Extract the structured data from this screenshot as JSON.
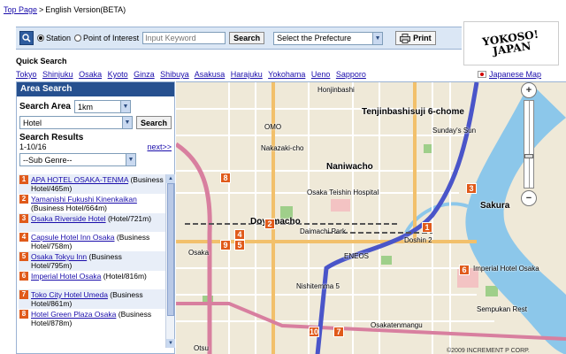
{
  "topnav": {
    "top_page": "Top Page",
    "separator": ">",
    "current": "English Version(BETA)"
  },
  "logo": {
    "line1": "YOKOSO!",
    "line2": "JAPAN"
  },
  "searchbar": {
    "radio_station": "Station",
    "radio_poi": "Point of Interest",
    "keyword_placeholder": "Input Keyword",
    "search_btn": "Search",
    "prefecture_label": "Select the Prefecture",
    "print_btn": "Print"
  },
  "quick_search": {
    "title": "Quick Search",
    "links": [
      "Tokyo",
      "Shinjuku",
      "Osaka",
      "Kyoto",
      "Ginza",
      "Shibuya",
      "Asakusa",
      "Harajuku",
      "Yokohama",
      "Ueno",
      "Sapporo"
    ]
  },
  "japanese_page": "Japanese Map",
  "panel": {
    "title": "Area Search",
    "search_area_label": "Search Area",
    "search_area_value": "1km",
    "category_value": "Hotel",
    "search_btn": "Search",
    "results_label": "Search Results",
    "results_range": "1-10/16",
    "next_label": "next>>",
    "subgenre_value": "--Sub Genre--"
  },
  "results": [
    {
      "n": "1",
      "name": "APA HOTEL OSAKA-TENMA",
      "info": "(Business Hotel/465m)"
    },
    {
      "n": "2",
      "name": "Yamanishi Fukushi Kinenkaikan",
      "info": "(Business Hotel/664m)"
    },
    {
      "n": "3",
      "name": "Osaka Riverside Hotel",
      "info": "(Hotel/721m)"
    },
    {
      "n": "4",
      "name": "Capsule Hotel Inn Osaka",
      "info": "(Business Hotel/758m)"
    },
    {
      "n": "5",
      "name": "Osaka Tokyu Inn",
      "info": "(Business Hotel/795m)"
    },
    {
      "n": "6",
      "name": "Imperial Hotel Osaka",
      "info": "(Hotel/816m)"
    },
    {
      "n": "7",
      "name": "Toko City Hotel Umeda",
      "info": "(Business Hotel/861m)"
    },
    {
      "n": "8",
      "name": "Hotel Green Plaza Osaka",
      "info": "(Business Hotel/878m)"
    }
  ],
  "map": {
    "labels": {
      "honjiro": "Honjinbashi",
      "tenjinbashi": "Tenjinbashisuji 6-chome",
      "sundays": "Sunday's Sun",
      "omo": "OMO",
      "nakazaki": "Nakazaki-cho",
      "naniwacho": "Naniwacho",
      "sakura": "Sakura",
      "teishin": "Osaka Teishin Hospital",
      "dayamacho": "Doyamacho",
      "daimachi": "Daimachi Park",
      "doshin": "Doshin 2",
      "osaka_st": "Osaka",
      "eneos": "ENEOS",
      "imperial": "Imperial Hotel Osaka",
      "nishitemma": "Nishitemma 5",
      "zahozan": "Osakatenmangu",
      "sempukan": "Sempukan Rest",
      "otsu": "Otsu"
    },
    "markers": [
      "1",
      "2",
      "3",
      "4",
      "5",
      "6",
      "7",
      "8",
      "9",
      "10"
    ],
    "copyright": "©2009 INCREMENT P CORP."
  }
}
